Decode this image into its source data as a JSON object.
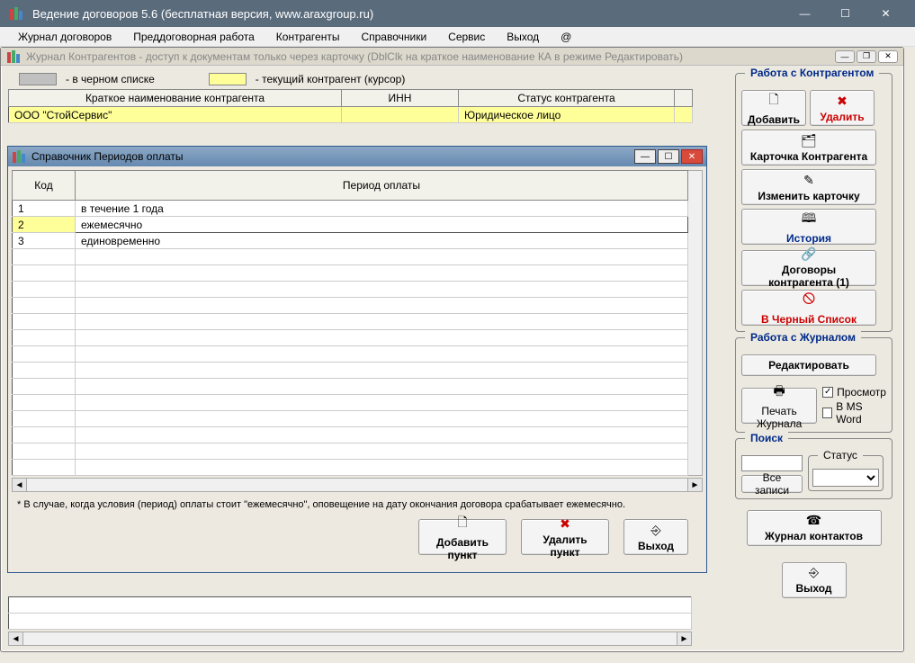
{
  "app": {
    "title": "Ведение договоров 5.6 (бесплатная версия, www.araxgroup.ru)"
  },
  "menubar": [
    "Журнал договоров",
    "Преддоговорная работа",
    "Контрагенты",
    "Справочники",
    "Сервис",
    "Выход",
    "@"
  ],
  "journal_window": {
    "title": "Журнал Контрагентов - доступ к документам только через карточку (DblClk на краткое наименование КА в режиме Редактировать)",
    "legend_blacklist": "- в черном списке",
    "legend_current": "- текущий контрагент (курсор)",
    "columns": {
      "name": "Краткое наименование контрагента",
      "inn": "ИНН",
      "status": "Статус контрагента"
    },
    "rows": [
      {
        "name": "ООО \"СтойСервис\"",
        "inn": "",
        "status": "Юридическое лицо"
      }
    ]
  },
  "dialog": {
    "title": "Справочник Периодов оплаты",
    "columns": {
      "code": "Код",
      "period": "Период оплаты"
    },
    "rows": [
      {
        "code": "1",
        "period": "в течение 1 года"
      },
      {
        "code": "2",
        "period": "ежемесячно"
      },
      {
        "code": "3",
        "period": "единовременно"
      }
    ],
    "hint": "* В случае, когда условия (период) оплаты стоит \"ежемесячно\", оповещение на дату окончания договора срабатывает ежемесячно.",
    "buttons": {
      "add": "Добавить пункт",
      "delete": "Удалить пункт",
      "exit": "Выход"
    }
  },
  "side": {
    "group1": {
      "title": "Работа с Контрагентом",
      "add": "Добавить",
      "delete": "Удалить",
      "card": "Карточка Контрагента",
      "edit_card": "Изменить карточку",
      "history": "История",
      "contracts": "Договоры контрагента (1)",
      "blacklist": "В Черный Список"
    },
    "group2": {
      "title": "Работа с Журналом",
      "edit": "Редактировать",
      "print": "Печать Журнала",
      "preview": "Просмотр",
      "msword": "В MS Word"
    },
    "group3": {
      "title": "Поиск",
      "all_records": "Все записи",
      "status_label": "Статус"
    },
    "contacts_journal": "Журнал контактов",
    "exit": "Выход"
  }
}
